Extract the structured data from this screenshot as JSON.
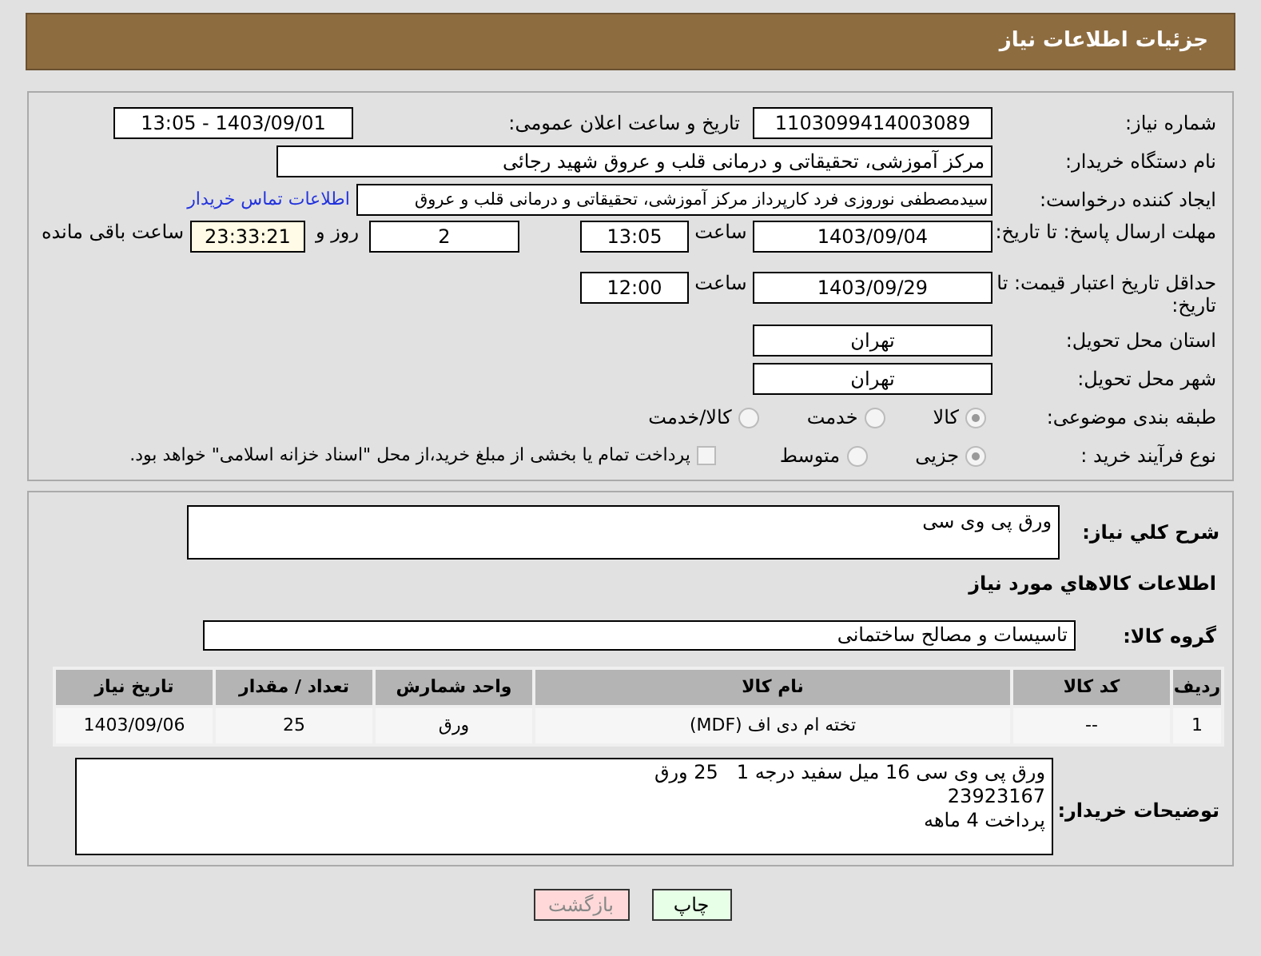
{
  "header": {
    "title": "جزئیات اطلاعات نیاز"
  },
  "fields": {
    "need_number": {
      "label": "شماره نیاز:",
      "value": "1103099414003089"
    },
    "announce": {
      "label": "تاریخ و ساعت اعلان عمومی:",
      "value": "1403/09/01 - 13:05"
    },
    "buyer_org": {
      "label": "نام دستگاه خریدار:",
      "value": "مرکز آموزشی، تحقیقاتی و درمانی قلب و عروق شهید رجائی"
    },
    "requester": {
      "label": "ایجاد کننده درخواست:",
      "value": "سیدمصطفی نوروزی فرد کارپرداز مرکز آموزشی، تحقیقاتی و درمانی قلب و عروق",
      "link": "اطلاعات تماس خریدار"
    },
    "deadline": {
      "label": "مهلت ارسال پاسخ: تا تاریخ:",
      "date": "1403/09/04",
      "time_label": "ساعت",
      "time": "13:05",
      "days": "2",
      "days_label": "روز و",
      "remaining": "23:33:21",
      "remaining_label": "ساعت باقی مانده"
    },
    "validity": {
      "label": "حداقل تاریخ اعتبار قیمت: تا تاریخ:",
      "date": "1403/09/29",
      "time_label": "ساعت",
      "time": "12:00"
    },
    "province": {
      "label": "استان محل تحویل:",
      "value": "تهران"
    },
    "city": {
      "label": "شهر محل تحویل:",
      "value": "تهران"
    },
    "category": {
      "label": "طبقه بندی موضوعی:",
      "options": [
        {
          "label": "کالا",
          "selected": true
        },
        {
          "label": "خدمت",
          "selected": false
        },
        {
          "label": "کالا/خدمت",
          "selected": false
        }
      ]
    },
    "process": {
      "label": "نوع فرآیند خرید :",
      "options": [
        {
          "label": "جزیی",
          "selected": true
        },
        {
          "label": "متوسط",
          "selected": false
        }
      ],
      "payment": {
        "label": "پرداخت تمام یا بخشی از مبلغ خرید،از محل \"اسناد خزانه اسلامی\" خواهد بود.",
        "checked": false
      }
    }
  },
  "description": {
    "label": "شرح کلي نياز:",
    "value": "ورق پی وی سی"
  },
  "goods_heading": "اطلاعات کالاهاي مورد نياز",
  "goods_group": {
    "label": "گروه کالا:",
    "value": "تاسیسات و مصالح ساختمانی"
  },
  "table": {
    "columns": [
      "ردیف",
      "کد کالا",
      "نام کالا",
      "واحد شمارش",
      "تعداد / مقدار",
      "تاریخ نیاز"
    ],
    "rows": [
      [
        "1",
        "--",
        "تخته ام دی اف (MDF)",
        "ورق",
        "25",
        "1403/09/06"
      ]
    ]
  },
  "buyer_notes": {
    "label": "توضیحات خریدار:",
    "lines": [
      "ورق پی وی سی 16 میل سفید درجه 1   25 ورق",
      "23923167",
      "پرداخت 4 ماهه"
    ]
  },
  "buttons": [
    {
      "label": "چاپ",
      "kind": "print"
    },
    {
      "label": "بازگشت",
      "kind": "back"
    }
  ]
}
